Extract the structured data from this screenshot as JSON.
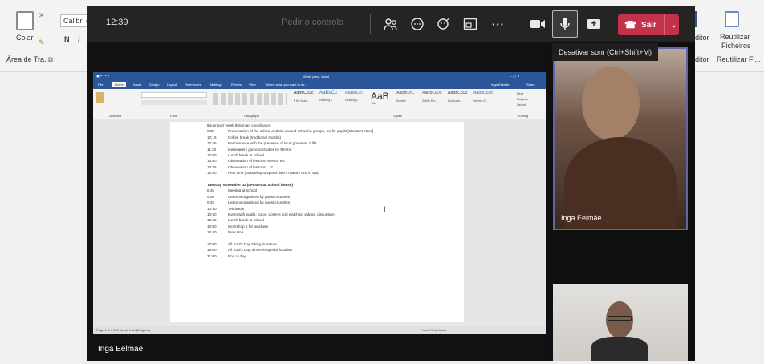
{
  "excel": {
    "paste_label": "Colar",
    "font_name": "Calibri (",
    "bold": "N",
    "italic": "I",
    "clipboard_group": "Área de Tra...",
    "editor_label_top": "ditor",
    "editor_label_bottom": "ditor",
    "reuse_label_1": "Reutilizar",
    "reuse_label_2": "Ficheiros",
    "reuse_group": "Reutilizar Fi..."
  },
  "teams": {
    "clock": "12:39",
    "request_control": "Pedir o controlo",
    "leave_label": "Sair",
    "mute_tooltip": "Desativar som (Ctrl+Shift+M)",
    "presenter_name": "Inga Eelmäe",
    "participants": [
      {
        "name": "Inga Eelmäe"
      },
      {
        "name": ""
      }
    ]
  },
  "word": {
    "title": "Week plan - Word",
    "user": "Inga Eelmäe",
    "share": "Share",
    "tabs": [
      "File",
      "Home",
      "Insert",
      "Design",
      "Layout",
      "References",
      "Mailings",
      "Review",
      "View"
    ],
    "tell_me": "Tell me what you want to do...",
    "styles": [
      {
        "preview": "AaBbCcDc",
        "name": "¶ No Spac..."
      },
      {
        "preview": "AaBbCc",
        "name": "Heading 1"
      },
      {
        "preview": "AaBbCcI",
        "name": "Heading 2"
      },
      {
        "preview": "AaB",
        "name": "Title"
      },
      {
        "preview": "AaBbCcC",
        "name": "Subtitle"
      },
      {
        "preview": "AaBbCcDc",
        "name": "Subtle Em..."
      },
      {
        "preview": "AaBbCcDc",
        "name": "Emphasis"
      },
      {
        "preview": "AaBbCcDc",
        "name": "Intense E..."
      }
    ],
    "groups": [
      "Clipboard",
      "Font",
      "Paragraph",
      "Styles",
      "Editing"
    ],
    "editing": [
      "Find",
      "Replace",
      "Select"
    ],
    "status_left": "Page 1 of 2   209 words   Irish (Belgium)",
    "status_right": "Focus   Read Mode",
    "document": [
      {
        "time": "",
        "text": "the project week [Estonian coordinator]"
      },
      {
        "time": "9:30",
        "text": "Presentation of the school and trip around school in groups, led by pupils [Mentor's class]"
      },
      {
        "time": "10:15",
        "text": "Coffee break (traditional snacks)"
      },
      {
        "time": "10:45",
        "text": "Performance with the presence of local governor. Gifts."
      },
      {
        "time": "11:30",
        "text": "Icebreakers games/activities by Mentor"
      },
      {
        "time": "12:00",
        "text": "Lunch break at school"
      },
      {
        "time": "13:00",
        "text": "Observation of lessons: Mentor etc"
      },
      {
        "time": "13:35",
        "text": "Observation of lessons: ...?"
      },
      {
        "time": "14:40",
        "text": "Free time (possibility to spend time in nature and in spa)"
      },
      {
        "time": "",
        "text": ""
      },
      {
        "time": "",
        "text": "Tuesday November 02 (Leotarmaa school house)"
      },
      {
        "time": "8:45",
        "text": "Meeting at school"
      },
      {
        "time": "9:00",
        "text": "Lessons organised by guest countries"
      },
      {
        "time": "9:45",
        "text": "Lessons organised by guest countries"
      },
      {
        "time": "10:40",
        "text": "Tea break"
      },
      {
        "time": "10:50",
        "text": "Event with pupils: logos, posters and watching videos, discussion"
      },
      {
        "time": "12:40",
        "text": "Lunch break at school"
      },
      {
        "time": "13:00",
        "text": "Workshop 1 for teachers"
      },
      {
        "time": "14:40",
        "text": "Free time"
      },
      {
        "time": "",
        "text": ""
      },
      {
        "time": "17:00",
        "text": "All Soul's Day hiking in nature"
      },
      {
        "time": "19:00",
        "text": "All Soul's Day dinner in special location"
      },
      {
        "time": "21:00",
        "text": "End of day"
      }
    ]
  },
  "colors": {
    "teams_bar": "#252423",
    "leave": "#c4314b",
    "active_border": "#6264a7",
    "word_blue": "#2b579a"
  }
}
